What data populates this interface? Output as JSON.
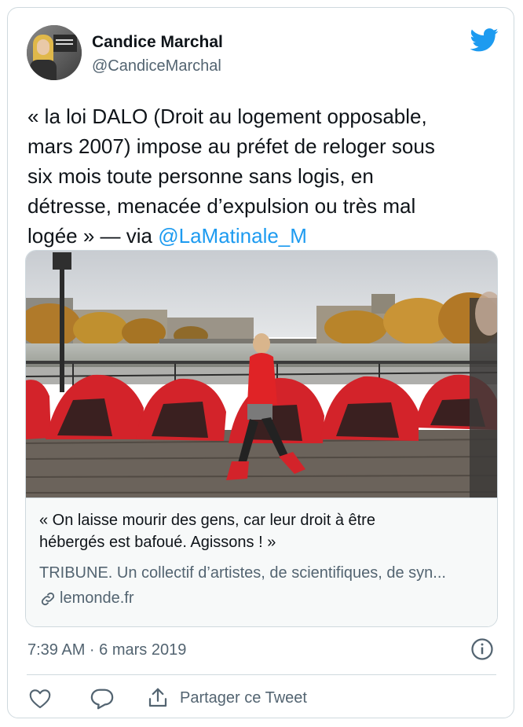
{
  "author": {
    "name": "Candice Marchal",
    "handle": "@CandiceMarchal"
  },
  "tweet": {
    "lines": [
      "« la loi DALO (Droit au logement opposable,",
      "mars 2007) impose au préfet de reloger sous",
      "six mois toute personne sans logis, en",
      "détresse, menacée d’expulsion ou très mal"
    ],
    "last_line_prefix": "logée » — via ",
    "mention": "@LaMatinale_M"
  },
  "card": {
    "title_lines": [
      "« On laisse mourir des gens, car leur droit à être",
      "hébergés est bafoué. Agissons ! »"
    ],
    "description": "TRIBUNE. Un collectif d’artistes, de scientifiques, de syn...",
    "domain": "lemonde.fr",
    "link_icon": "link-icon"
  },
  "timestamp": "7:39 AM · 6 mars 2019",
  "actions": {
    "share_label": "Partager ce Tweet"
  },
  "icons": [
    "twitter-bird-icon",
    "info-icon",
    "heart-icon",
    "reply-icon",
    "share-icon"
  ],
  "colors": {
    "accent": "#1d9bf0",
    "text": "#0f1419",
    "secondary": "#536471",
    "border": "#cfd9de",
    "tent": "#d3232a"
  }
}
